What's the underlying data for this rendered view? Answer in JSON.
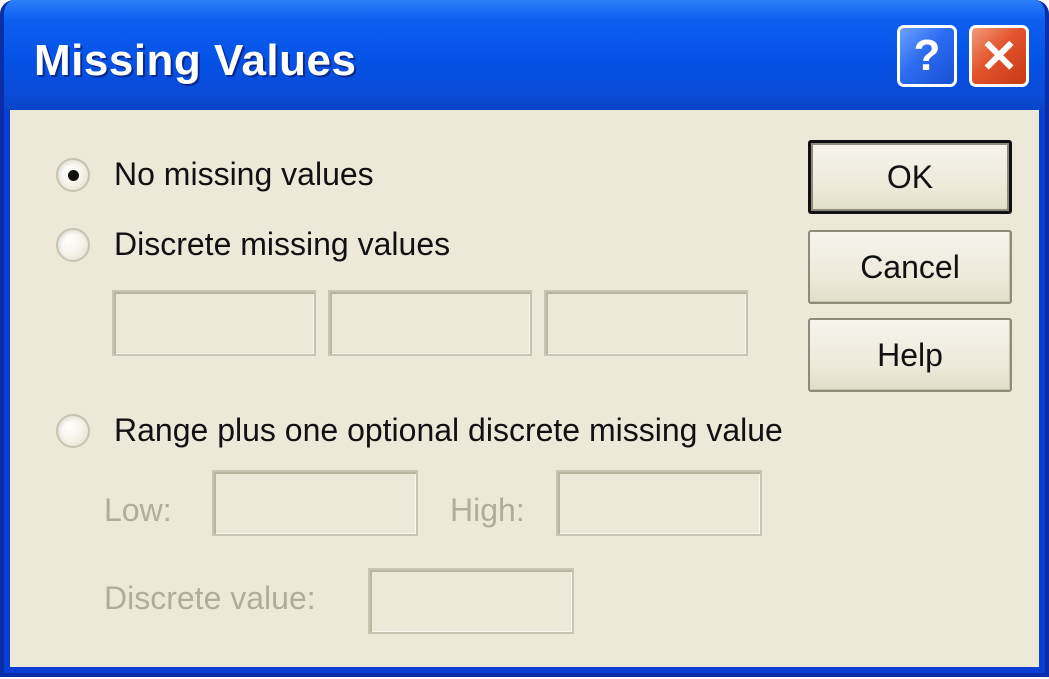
{
  "window": {
    "title": "Missing Values",
    "help_caption": "?",
    "close_caption": "✕"
  },
  "options": {
    "no_missing": {
      "label": "No missing values",
      "selected": true
    },
    "discrete": {
      "label": "Discrete missing values",
      "selected": false
    },
    "range": {
      "label": "Range plus one optional discrete missing value",
      "selected": false
    }
  },
  "discrete_fields": [
    "",
    "",
    ""
  ],
  "range_fields": {
    "low_label": "Low:",
    "high_label": "High:",
    "discrete_value_label": "Discrete value:",
    "low_value": "",
    "high_value": "",
    "discrete_value": ""
  },
  "buttons": {
    "ok": "OK",
    "cancel": "Cancel",
    "help": "Help"
  },
  "colors": {
    "titlebar": "#0552e6",
    "dialog_bg": "#ece9d8",
    "close_button": "#e2532c",
    "disabled_text": "#b0ad9c"
  }
}
